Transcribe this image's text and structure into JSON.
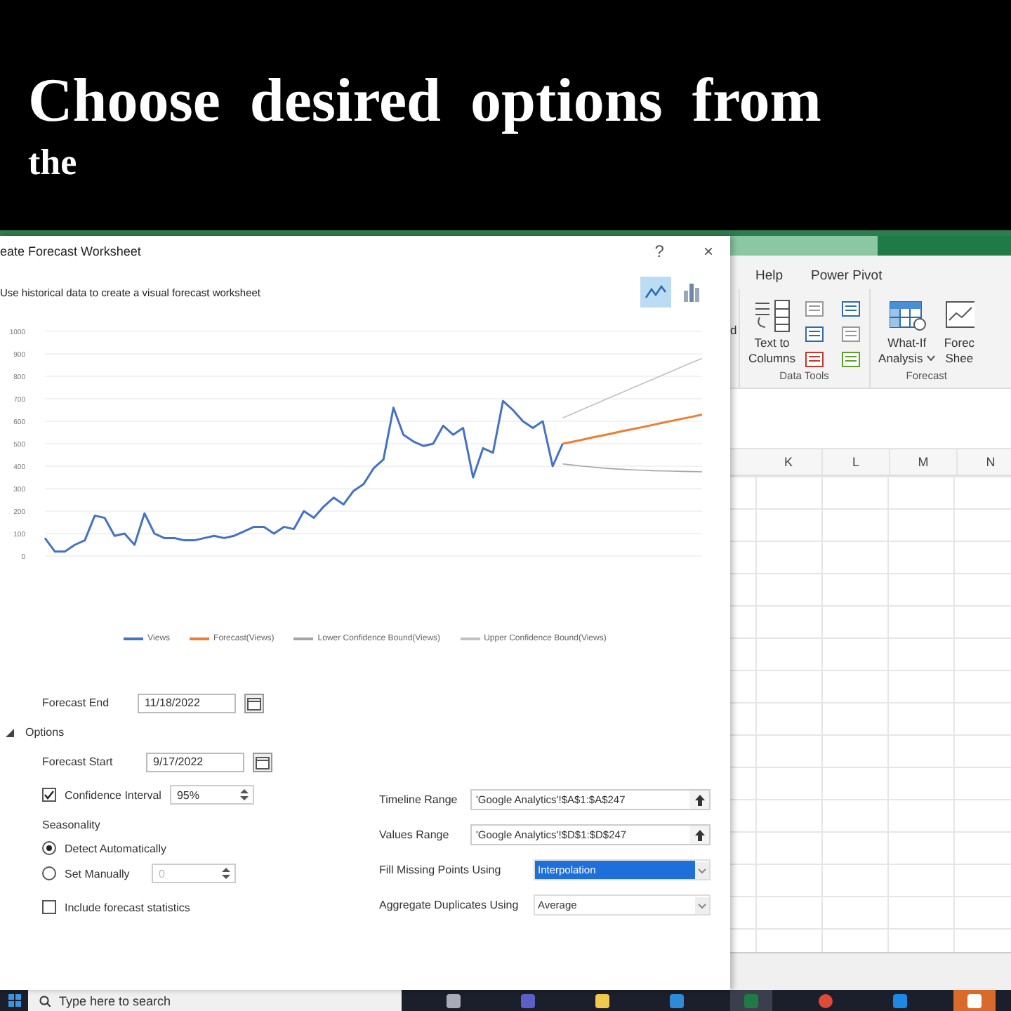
{
  "caption": {
    "lines": [
      "Choose desired options from",
      "the"
    ]
  },
  "dialog": {
    "title": "eate Forecast Worksheet",
    "help": "?",
    "close": "×",
    "subtitle": "Use historical data to create a visual forecast worksheet",
    "chart_types": [
      {
        "kind": "line",
        "selected": true
      },
      {
        "kind": "column",
        "selected": false
      }
    ],
    "chart_data": {
      "type": "line",
      "grid": true,
      "ylim": [
        0,
        1000
      ],
      "yticks": [
        0,
        100,
        200,
        300,
        400,
        500,
        600,
        700,
        800,
        900,
        1000
      ],
      "series": [
        {
          "name": "Views",
          "color": "#4472c4",
          "values": [
            80,
            20,
            20,
            50,
            70,
            180,
            170,
            90,
            100,
            50,
            190,
            100,
            80,
            80,
            70,
            70,
            80,
            90,
            80,
            90,
            110,
            130,
            130,
            100,
            130,
            120,
            200,
            170,
            220,
            260,
            230,
            290,
            320,
            390,
            430,
            660,
            540,
            510,
            490,
            500,
            580,
            540,
            570,
            350,
            480,
            460,
            690,
            650,
            600,
            570,
            600,
            400,
            500,
            null,
            null,
            null,
            null,
            null,
            null,
            null,
            null,
            null,
            null,
            null,
            null,
            null,
            null
          ]
        },
        {
          "name": "Forecast(Views)",
          "color": "#ed7d31",
          "values": [
            null,
            null,
            null,
            null,
            null,
            null,
            null,
            null,
            null,
            null,
            null,
            null,
            null,
            null,
            null,
            null,
            null,
            null,
            null,
            null,
            null,
            null,
            null,
            null,
            null,
            null,
            null,
            null,
            null,
            null,
            null,
            null,
            null,
            null,
            null,
            null,
            null,
            null,
            null,
            null,
            null,
            null,
            null,
            null,
            null,
            null,
            null,
            null,
            null,
            null,
            null,
            null,
            500,
            509,
            518,
            528,
            537,
            546,
            556,
            565,
            574,
            583,
            593,
            602,
            611,
            620,
            630
          ]
        },
        {
          "name": "Lower Confidence Bound(Views)",
          "color": "#a5a5a5",
          "values": [
            null,
            null,
            null,
            null,
            null,
            null,
            null,
            null,
            null,
            null,
            null,
            null,
            null,
            null,
            null,
            null,
            null,
            null,
            null,
            null,
            null,
            null,
            null,
            null,
            null,
            null,
            null,
            null,
            null,
            null,
            null,
            null,
            null,
            null,
            null,
            null,
            null,
            null,
            null,
            null,
            null,
            null,
            null,
            null,
            null,
            null,
            null,
            null,
            null,
            null,
            null,
            null,
            410,
            405,
            400,
            396,
            392,
            389,
            386,
            384,
            382,
            380,
            379,
            378,
            377,
            376,
            375
          ]
        },
        {
          "name": "Upper Confidence Bound(Views)",
          "color": "#c0c0c0",
          "values": [
            null,
            null,
            null,
            null,
            null,
            null,
            null,
            null,
            null,
            null,
            null,
            null,
            null,
            null,
            null,
            null,
            null,
            null,
            null,
            null,
            null,
            null,
            null,
            null,
            null,
            null,
            null,
            null,
            null,
            null,
            null,
            null,
            null,
            null,
            null,
            null,
            null,
            null,
            null,
            null,
            null,
            null,
            null,
            null,
            null,
            null,
            null,
            null,
            null,
            null,
            null,
            null,
            615,
            634,
            653,
            672,
            691,
            710,
            729,
            748,
            767,
            786,
            805,
            824,
            843,
            862,
            880
          ]
        }
      ]
    },
    "forecast_end": {
      "label": "Forecast End",
      "value": "11/18/2022"
    },
    "options": {
      "label": "Options",
      "expanded": true
    },
    "forecast_start": {
      "label": "Forecast Start",
      "value": "9/17/2022"
    },
    "confidence": {
      "label": "Confidence Interval",
      "checked": true,
      "value": "95%"
    },
    "seasonality": {
      "label": "Seasonality",
      "choices": [
        {
          "label": "Detect Automatically",
          "selected": true
        },
        {
          "label": "Set Manually",
          "selected": false,
          "value": "0"
        }
      ]
    },
    "statistics": {
      "label": "Include forecast statistics",
      "checked": false
    },
    "ranges": [
      {
        "kind": "range",
        "label": "Timeline Range",
        "value": "'Google Analytics'!$A$1:$A$247"
      },
      {
        "kind": "range",
        "label": "Values Range",
        "value": "'Google Analytics'!$D$1:$D$247"
      },
      {
        "kind": "select",
        "label": "Fill Missing Points Using",
        "value": "Interpolation",
        "focused": true
      },
      {
        "kind": "select",
        "label": "Aggregate Duplicates Using",
        "value": "Average",
        "focused": false
      }
    ]
  },
  "excel": {
    "ribbon_tabs": [
      "Help",
      "Power Pivot"
    ],
    "leftover": "d",
    "groups": [
      {
        "label": "Data Tools",
        "buttons": [
          {
            "kind": "text-to-columns",
            "lines": [
              "Text to",
              "Columns"
            ]
          }
        ]
      },
      {
        "label": "Forecast",
        "buttons": [
          {
            "kind": "what-if",
            "lines": [
              "What-If",
              "Analysis"
            ],
            "caret": true
          },
          {
            "kind": "forecast-sheet",
            "lines": [
              "Forec",
              "Shee"
            ]
          }
        ]
      }
    ],
    "columns": [
      "K",
      "L",
      "M",
      "N"
    ]
  },
  "taskbar": {
    "search_placeholder": "Type here to search"
  }
}
